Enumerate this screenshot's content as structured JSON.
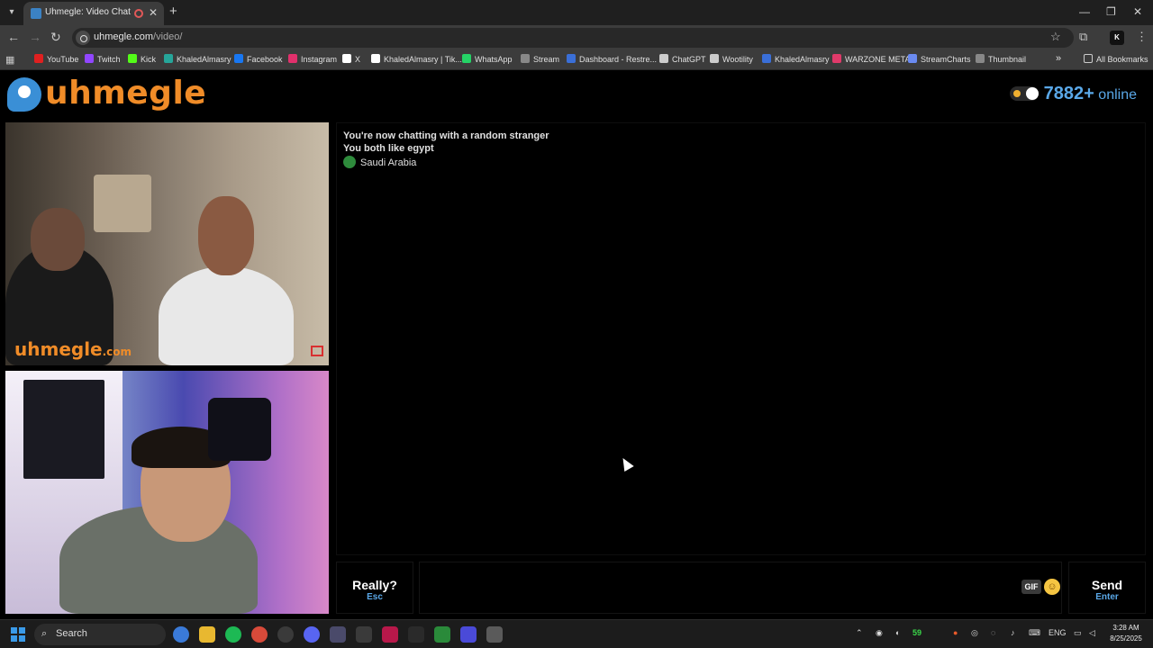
{
  "browser": {
    "tab_title": "Uhmegle: Video Chat | Ome",
    "url_host": "uhmegle.com",
    "url_path": "/video/",
    "bookmarks": [
      {
        "label": "YouTube",
        "color": "#e02020"
      },
      {
        "label": "Twitch",
        "color": "#9146ff"
      },
      {
        "label": "Kick",
        "color": "#53fc18"
      },
      {
        "label": "KhaledAlmasry",
        "color": "#26a69a"
      },
      {
        "label": "Facebook",
        "color": "#1877f2"
      },
      {
        "label": "Instagram",
        "color": "#e1306c"
      },
      {
        "label": "X",
        "color": "#ffffff"
      },
      {
        "label": "KhaledAlmasry | Tik...",
        "color": "#ffffff"
      },
      {
        "label": "WhatsApp",
        "color": "#25d366"
      },
      {
        "label": "Stream",
        "color": "#888888"
      },
      {
        "label": "Dashboard - Restre...",
        "color": "#3a6fd8"
      },
      {
        "label": "ChatGPT",
        "color": "#cccccc"
      },
      {
        "label": "Wootility",
        "color": "#cccccc"
      },
      {
        "label": "KhaledAlmasry",
        "color": "#3a6fd8"
      },
      {
        "label": "WARZONE META",
        "color": "#e03a6a"
      },
      {
        "label": "StreamCharts",
        "color": "#6a8af0"
      },
      {
        "label": "Thumbnail",
        "color": "#888888"
      }
    ],
    "all_bookmarks": "All Bookmarks"
  },
  "site": {
    "logo": "uhmegle",
    "online_count": "7882+",
    "online_label": "online",
    "watermark": "uhmegle",
    "watermark_suffix": ".com"
  },
  "chat": {
    "messages": [
      "You're now chatting with a random stranger",
      "You both like egypt"
    ],
    "country": "Saudi Arabia"
  },
  "controls": {
    "esc_label": "Really?",
    "esc_hint": "Esc",
    "gif_label": "GIF",
    "send_label": "Send",
    "send_hint": "Enter"
  },
  "taskbar": {
    "search_label": "Search",
    "lang": "ENG",
    "time": "3:28 AM",
    "date": "8/25/2025",
    "tray_number": "59"
  }
}
